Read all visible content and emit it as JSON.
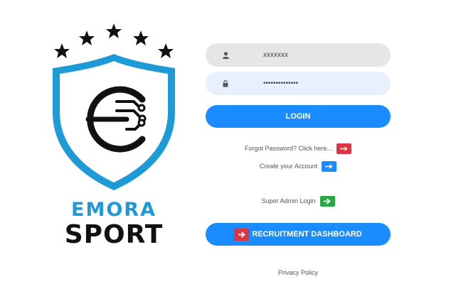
{
  "brand": {
    "line1": "EMORA",
    "line2": "SPORT",
    "logo_monogram_icon": "emora-circuit-e-icon",
    "colors": {
      "shield": "#1e9bd7",
      "text_blue": "#1e9bd7",
      "text_dark": "#111111"
    }
  },
  "login_form": {
    "username": {
      "value": "xxxxxxx",
      "icon": "user-icon"
    },
    "password": {
      "value": "••••••••••••••",
      "icon": "lock-icon"
    },
    "login_label": "LOGIN",
    "forgot_text": "Forgot Password? Click here...",
    "create_text": "Create your Account",
    "super_admin_text": "Super Admin Login",
    "recruitment_label": "RECRUITMENT DASHBOARD",
    "privacy_text": "Privacy Policy"
  },
  "colors": {
    "primary": "#1a8cff",
    "danger": "#dc3545",
    "success": "#28a745"
  }
}
